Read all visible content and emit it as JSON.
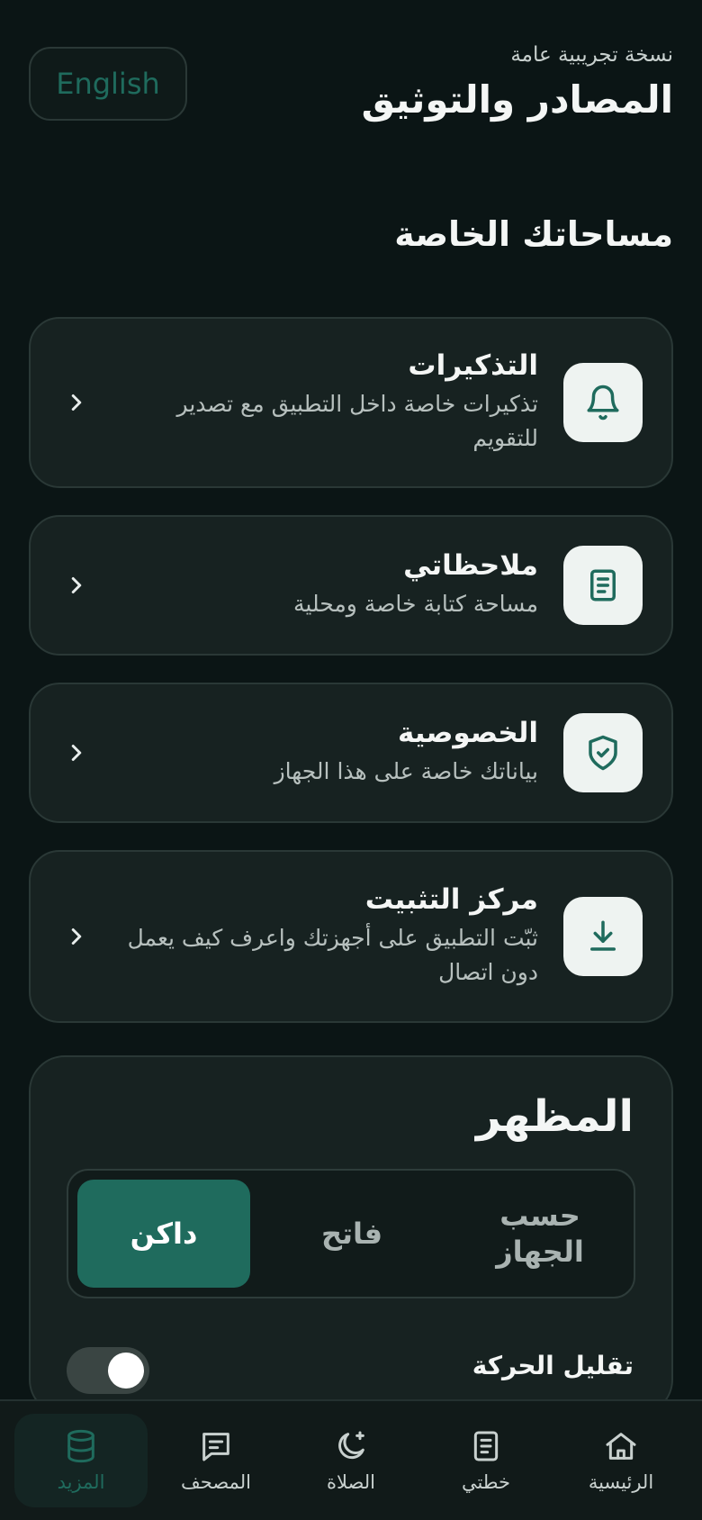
{
  "header": {
    "language_button": "English",
    "subtitle": "نسخة تجريبية عامة",
    "title": "المصادر والتوثيق"
  },
  "section_title": "مساحاتك الخاصة",
  "cards": [
    {
      "title": "التذكيرات",
      "desc": "تذكيرات خاصة داخل التطبيق مع تصدير للتقويم",
      "icon": "bell-icon"
    },
    {
      "title": "ملاحظاتي",
      "desc": "مساحة كتابة خاصة ومحلية",
      "icon": "notes-icon"
    },
    {
      "title": "الخصوصية",
      "desc": "بياناتك خاصة على هذا الجهاز",
      "icon": "shield-check-icon"
    },
    {
      "title": "مركز التثبيت",
      "desc": "ثبّت التطبيق على أجهزتك واعرف كيف يعمل دون اتصال",
      "icon": "download-icon"
    }
  ],
  "appearance": {
    "title": "المظهر",
    "options": {
      "system": "حسب الجهاز",
      "light": "فاتح",
      "dark": "داكن"
    },
    "selected": "dark",
    "reduce_motion_label": "تقليل الحركة"
  },
  "bottom_nav": [
    {
      "label": "الرئيسية",
      "icon": "home-icon"
    },
    {
      "label": "خطتي",
      "icon": "plan-icon"
    },
    {
      "label": "الصلاة",
      "icon": "moon-star-icon"
    },
    {
      "label": "المصحف",
      "icon": "quran-icon"
    },
    {
      "label": "المزيد",
      "icon": "database-icon",
      "active": true
    }
  ],
  "colors": {
    "background": "#0b1515",
    "card": "#172221",
    "accent": "#1f6b5d",
    "icon_tile": "#eef3f1"
  }
}
